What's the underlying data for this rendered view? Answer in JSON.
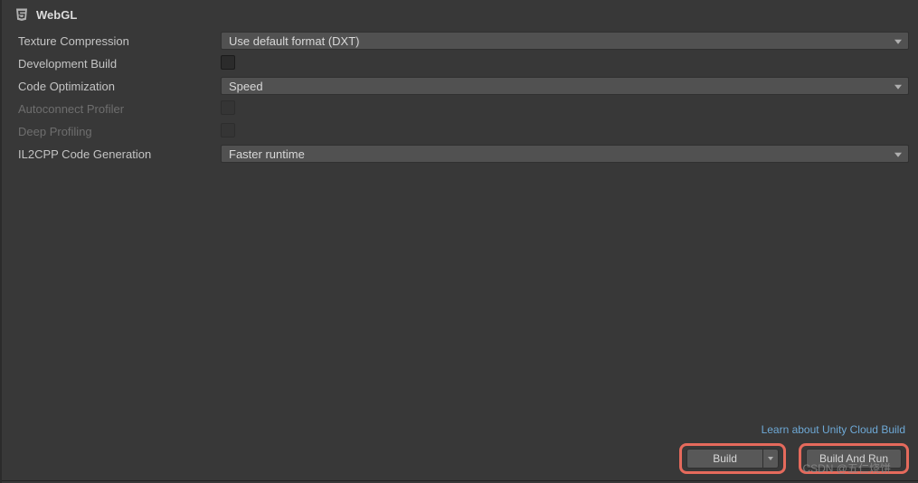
{
  "header": {
    "title": "WebGL"
  },
  "settings": {
    "texture_compression": {
      "label": "Texture Compression",
      "value": "Use default format (DXT)"
    },
    "development_build": {
      "label": "Development Build",
      "checked": false
    },
    "code_optimization": {
      "label": "Code Optimization",
      "value": "Speed"
    },
    "autoconnect_profiler": {
      "label": "Autoconnect Profiler",
      "checked": false,
      "disabled": true
    },
    "deep_profiling": {
      "label": "Deep Profiling",
      "checked": false,
      "disabled": true
    },
    "il2cpp_code_generation": {
      "label": "IL2CPP Code Generation",
      "value": "Faster runtime"
    }
  },
  "footer": {
    "learn_link": "Learn about Unity Cloud Build",
    "build_button": "Build",
    "build_and_run_button": "Build And Run"
  },
  "watermark": {
    "text": "CSDN @五仁烧饼"
  }
}
